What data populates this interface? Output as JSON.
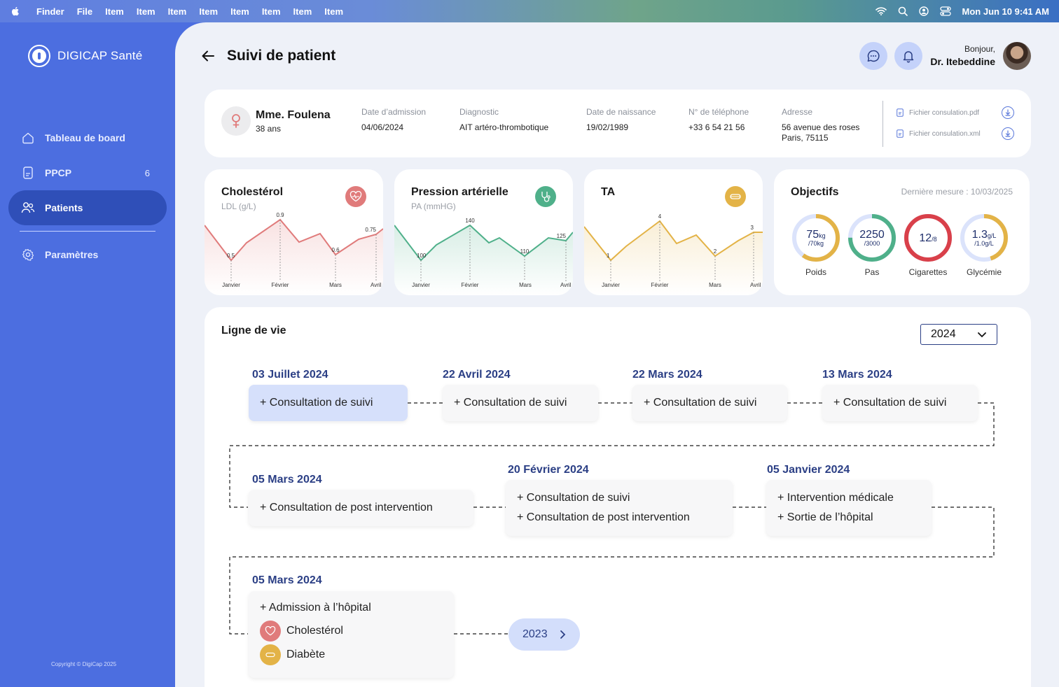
{
  "menubar": {
    "app": "Finder",
    "items": [
      "File",
      "Item",
      "Item",
      "Item",
      "Item",
      "Item",
      "Item",
      "Item",
      "Item",
      "Item"
    ],
    "datetime": "Mon Jun 10  9:41 AM"
  },
  "sidebar": {
    "brand": "DIGICAP Santé",
    "items": [
      {
        "label": "Tableau de board",
        "icon": "home-icon"
      },
      {
        "label": "PPCP",
        "icon": "document-icon",
        "count": "6"
      },
      {
        "label": "Patients",
        "icon": "users-icon",
        "active": true
      },
      {
        "label": "Paramètres",
        "icon": "settings-icon"
      }
    ],
    "copyright": "Copyright © DigiCap 2025"
  },
  "header": {
    "title": "Suivi de patient",
    "greeting": "Bonjour,",
    "doctor": "Dr. Itebeddine"
  },
  "patient": {
    "name": "Mme. Foulena",
    "age": "38 ans",
    "fields": [
      {
        "label": "Date d’admission",
        "value": "04/06/2024"
      },
      {
        "label": "Diagnostic",
        "value": "AIT artéro-thrombotique"
      },
      {
        "label": "Date de naissance",
        "value": "19/02/1989"
      },
      {
        "label": "N° de téléphone",
        "value": "+33 6 54 21 56"
      },
      {
        "label": "Adresse",
        "value": "56 avenue des roses",
        "value2": "Paris, 75115"
      }
    ],
    "files": [
      "Fichier consulation.pdf",
      "Fichier consulation.xml"
    ]
  },
  "metrics": [
    {
      "title": "Cholestérol",
      "subtitle": "LDL (g/L)",
      "color": "#e07b7b",
      "months": [
        "Janvier",
        "Février",
        "Mars",
        "Avril"
      ],
      "labels": [
        "0.5",
        "0.9",
        "0.6",
        "0.75"
      ]
    },
    {
      "title": "Pression artérielle",
      "subtitle": "PA (mmHG)",
      "color": "#4fb08a",
      "months": [
        "Janvier",
        "Février",
        "Mars",
        "Avril"
      ],
      "labels": [
        "100",
        "140",
        "110",
        "125"
      ]
    },
    {
      "title": "TA",
      "subtitle": "",
      "color": "#e3b347",
      "months": [
        "Janvier",
        "Février",
        "Mars",
        "Avril"
      ],
      "labels": [
        "1",
        "4",
        "2",
        "3"
      ]
    }
  ],
  "objectifs": {
    "title": "Objectifs",
    "last": "Dernière mesure : 10/03/2025",
    "gauges": [
      {
        "value": "75",
        "unit": "kg",
        "target": "/70kg",
        "label": "Poids",
        "color": "#e3b347",
        "fill": 0.6
      },
      {
        "value": "2250",
        "unit": "",
        "target": "/3000",
        "label": "Pas",
        "color": "#4fb08a",
        "fill": 0.75
      },
      {
        "value": "12",
        "unit": "/8",
        "target": "",
        "label": "Cigarettes",
        "color": "#d9404a",
        "fill": 1.0
      },
      {
        "value": "1.3",
        "unit": "g/L",
        "target": "/1.0g/L",
        "label": "Glycémie",
        "color": "#e3b347",
        "fill": 0.45
      }
    ]
  },
  "timeline": {
    "title": "Ligne de vie",
    "year": "2024",
    "events": [
      {
        "date": "03 Juillet 2024",
        "lines": [
          "+ Consultation de suivi"
        ]
      },
      {
        "date": "22 Avril 2024",
        "lines": [
          "+ Consultation de suivi"
        ]
      },
      {
        "date": "22 Mars 2024",
        "lines": [
          "+ Consultation de suivi"
        ]
      },
      {
        "date": "13 Mars 2024",
        "lines": [
          "+ Consultation de suivi"
        ]
      },
      {
        "date": "05 Mars 2024",
        "lines": [
          "+ Consultation de post intervention"
        ]
      },
      {
        "date": "20 Février 2024",
        "lines": [
          "+ Consultation de suivi",
          "+ Consultation de post intervention"
        ]
      },
      {
        "date": "05 Janvier 2024",
        "lines": [
          "+ Intervention médicale",
          "+ Sortie de l’hôpital"
        ]
      },
      {
        "date": "05 Mars 2024",
        "lines": [
          "+ Admission à l’hôpital"
        ],
        "tags": [
          "Cholestérol",
          "Diabète"
        ]
      }
    ],
    "prev_year": "2023"
  }
}
